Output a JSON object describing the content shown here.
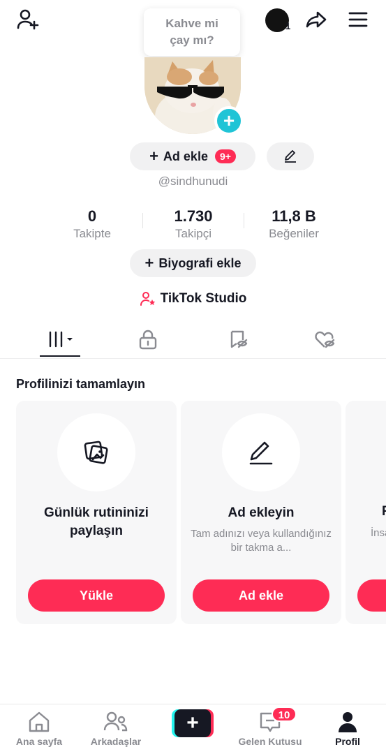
{
  "header": {
    "speech_bubble_line1": "Kahve mi",
    "speech_bubble_line2": "çay mı?",
    "account_switch_count": "1"
  },
  "profile": {
    "add_name_label": "Ad ekle",
    "add_name_badge": "9+",
    "username": "@sindhunudi",
    "stats": [
      {
        "value": "0",
        "label": "Takipte"
      },
      {
        "value": "1.730",
        "label": "Takipçi"
      },
      {
        "value": "11,8 B",
        "label": "Beğeniler"
      }
    ],
    "bio_label": "Biyografi ekle",
    "studio_label": "TikTok Studio"
  },
  "tabs": {
    "active_index": 0,
    "items": [
      "videos-grid-icon",
      "lock-icon",
      "tagged-posts-icon",
      "liked-videos-icon"
    ]
  },
  "complete_profile": {
    "title": "Profilinizi tamamlayın",
    "cards": [
      {
        "title": "Günlük rutininizi paylaşın",
        "subtitle": "",
        "button": "Yükle",
        "icon": "photo-stack-icon"
      },
      {
        "title": "Ad ekleyin",
        "subtitle": "Tam adınızı veya kullandığınız bir takma a...",
        "button": "Ad ekle",
        "icon": "pencil-icon"
      },
      {
        "title": "F",
        "subtitle": "İnsa",
        "button": "",
        "icon": ""
      }
    ]
  },
  "bottom_nav": {
    "home": "Ana sayfa",
    "friends": "Arkadaşlar",
    "inbox": "Gelen Kutusu",
    "inbox_badge": "10",
    "profile": "Profil"
  },
  "colors": {
    "accent": "#fe2c55",
    "teal": "#25f4ee",
    "avatar_plus": "#20c4d6",
    "text_primary": "#161823",
    "text_secondary": "#8a8b91"
  }
}
